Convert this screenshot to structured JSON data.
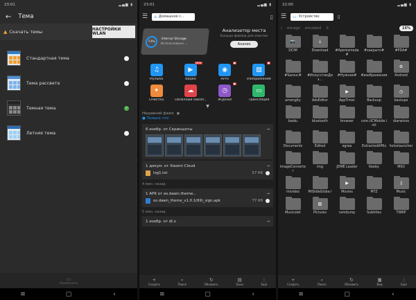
{
  "panel1": {
    "status_time": "23:01",
    "title": "Тема",
    "scan_text": "Скачать темы",
    "scan_button": "НАСТРОЙКИ WLAN",
    "themes": [
      {
        "name": "Стандартная тема",
        "selected": false,
        "bar": "#2f7ec7",
        "tile": "#f0a030"
      },
      {
        "name": "Тема рассвета",
        "selected": false,
        "bar": "#4d8fd6",
        "tile": "#7db3e8"
      },
      {
        "name": "Темная тема",
        "selected": true,
        "bar": "#222222",
        "tile": "#888888"
      },
      {
        "name": "Летняя тема",
        "selected": false,
        "bar": "#2c6eb5",
        "tile": "#9fd0f5"
      }
    ],
    "bottom_label": "Применить"
  },
  "panel2": {
    "status_time": "23:01",
    "path": "Домашняя с...",
    "device_name": "Internal Storage",
    "device_pct": "73%",
    "device_sub": "Использовано ...",
    "analyzer_title": "Анализатор места",
    "analyzer_sub": "Больше файлов для очистки",
    "analyzer_button": "Анализ",
    "apps": [
      {
        "label": "Музыка",
        "color": "#2196f3",
        "glyph": "♫",
        "badge": ""
      },
      {
        "label": "Видео",
        "color": "#2196f3",
        "glyph": "▶",
        "badge": "NEW"
      },
      {
        "label": "APPs",
        "color": "#2196f3",
        "glyph": "◉",
        "badge": "●"
      },
      {
        "label": "Изображения",
        "color": "#2196f3",
        "glyph": "▨",
        "badge": "●"
      },
      {
        "label": "Очистка",
        "color": "#f08a3c",
        "glyph": "✦",
        "badge": ""
      },
      {
        "label": "Облачный накоп...",
        "color": "#e0444a",
        "glyph": "☁",
        "badge": ""
      },
      {
        "label": "Журнал",
        "color": "#8d58c8",
        "glyph": "◷",
        "badge": "●"
      },
      {
        "label": "Трансляция",
        "color": "#2fb86b",
        "glyph": "▭",
        "badge": ""
      }
    ],
    "recent_title": "Недавний файл",
    "recent_sub": "Только что",
    "card1_title": "6 изобр. от Скриншоты",
    "card2_title": "1 докум. от Xiaomi Cloud",
    "card2_file": "log1.txt",
    "card2_size": "57 Кб",
    "time2": "4 мин. назад",
    "card3_title": "1 APK от es.dawn.theme...",
    "card3_file": "es.dawn_theme_v1.0.1(69)_sign.apk",
    "card3_size": "77 Кб",
    "time3": "5 мин. назад",
    "card4_title": "1 изобр. от dl.x",
    "tools": [
      {
        "glyph": "+",
        "label": "Создать"
      },
      {
        "glyph": "⌕",
        "label": "Поиск"
      },
      {
        "glyph": "↻",
        "label": "Обновить"
      },
      {
        "glyph": "▤",
        "label": "Окно"
      },
      {
        "glyph": "⋮",
        "label": "Ещё"
      }
    ]
  },
  "panel3": {
    "status_time": "22:00",
    "path": "Устройство",
    "crumbs": [
      "/",
      "storage",
      "emulated",
      "0"
    ],
    "storage_pct": "15%",
    "folders": [
      {
        "name": "DCIM",
        "glyph": "📷"
      },
      {
        "name": "Download",
        "glyph": "↓"
      },
      {
        "name": "#Aperosmoda#",
        "glyph": ""
      },
      {
        "name": "#закрыто#",
        "glyph": ""
      },
      {
        "name": "#PDA#",
        "glyph": ""
      },
      {
        "name": "#Sarouc#",
        "glyph": ""
      },
      {
        "name": "#ИскусствоДиз...",
        "glyph": ""
      },
      {
        "name": "#Нужное#",
        "glyph": ""
      },
      {
        "name": "#изображения",
        "glyph": ""
      },
      {
        "name": "Android",
        "glyph": "⚙"
      },
      {
        "name": "amengity",
        "glyph": ""
      },
      {
        "name": "AdsEditor",
        "glyph": ""
      },
      {
        "name": "AppTimer",
        "glyph": "▶"
      },
      {
        "name": "Backuup",
        "glyph": ""
      },
      {
        "name": "backups",
        "glyph": "◷"
      },
      {
        "name": "baidu",
        "glyph": ""
      },
      {
        "name": "bluetooth",
        "glyph": ""
      },
      {
        "name": "browser",
        "glyph": ""
      },
      {
        "name": "com.UCMobile.intl",
        "glyph": ""
      },
      {
        "name": "diarwinos",
        "glyph": ""
      },
      {
        "name": "Documents",
        "glyph": ""
      },
      {
        "name": "Edited",
        "glyph": ""
      },
      {
        "name": "egrea",
        "glyph": ""
      },
      {
        "name": "ExtractedAPKs",
        "glyph": ""
      },
      {
        "name": "holoslauncher",
        "glyph": ""
      },
      {
        "name": "ImageConverter",
        "glyph": ""
      },
      {
        "name": "img",
        "glyph": ""
      },
      {
        "name": "JDME Leader",
        "glyph": ""
      },
      {
        "name": "Keeby",
        "glyph": ""
      },
      {
        "name": "MIUI",
        "glyph": ""
      },
      {
        "name": "mivideo",
        "glyph": ""
      },
      {
        "name": "MiSlideGloba l",
        "glyph": ""
      },
      {
        "name": "Movies",
        "glyph": "▶"
      },
      {
        "name": "MTZ",
        "glyph": ""
      },
      {
        "name": "Music",
        "glyph": "♫"
      },
      {
        "name": "Musicolet",
        "glyph": ""
      },
      {
        "name": "Pictures",
        "glyph": "▨"
      },
      {
        "name": "ramdump",
        "glyph": ""
      },
      {
        "name": "Subtitles",
        "glyph": ""
      },
      {
        "name": "TWRP",
        "glyph": ""
      }
    ],
    "tools": [
      {
        "glyph": "+",
        "label": "Создать"
      },
      {
        "glyph": "⌕",
        "label": "Поиск"
      },
      {
        "glyph": "↻",
        "label": "Обновить"
      },
      {
        "glyph": "▦",
        "label": "Вид"
      },
      {
        "glyph": "⋮",
        "label": "Ещё"
      }
    ]
  }
}
